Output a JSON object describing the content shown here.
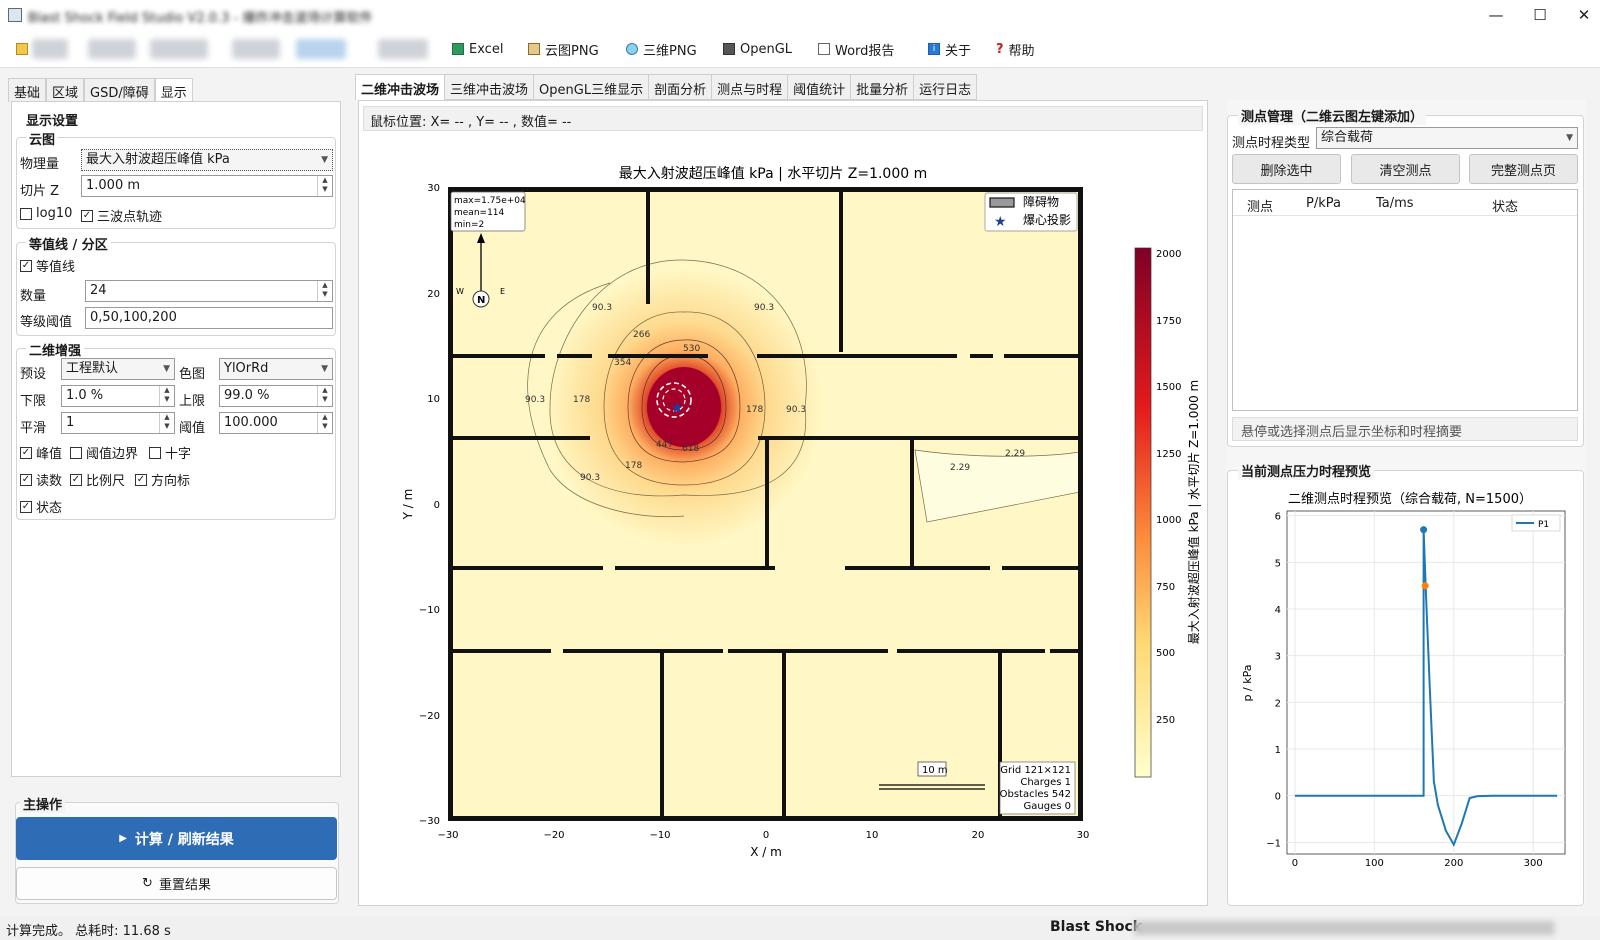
{
  "window": {
    "title": "Blast Shock Field Studio V2.0.3 - 爆炸冲击波场计算软件",
    "controls": [
      "—",
      "☐",
      "✕"
    ]
  },
  "toolbar": {
    "items": [
      {
        "label": "Excel",
        "icon": "excel-icon"
      },
      {
        "label": "云图PNG",
        "icon": "image-icon"
      },
      {
        "label": "三维PNG",
        "icon": "globe-icon"
      },
      {
        "label": "OpenGL",
        "icon": "opengl-icon"
      },
      {
        "label": "Word报告",
        "icon": "document-icon"
      },
      {
        "label": "关于",
        "icon": "info-icon"
      },
      {
        "label": "帮助",
        "icon": "help-icon"
      }
    ]
  },
  "left_tabs": [
    "基础",
    "区域",
    "GSD/障碍",
    "显示"
  ],
  "display": {
    "title": "显示设置",
    "cloud": {
      "title": "云图",
      "quantity_label": "物理量",
      "quantity_value": "最大入射波超压峰值 kPa",
      "slice_label": "切片 Z",
      "slice_value": "1.000 m",
      "log10_label": "log10",
      "log10_checked": false,
      "triple_label": "三波点轨迹",
      "triple_checked": true
    },
    "contour": {
      "title": "等值线 / 分区",
      "enable_label": "等值线",
      "enable_checked": true,
      "count_label": "数量",
      "count_value": "24",
      "levels_label": "等级阈值",
      "levels_value": "0,50,100,200"
    },
    "enhance": {
      "title": "二维增强",
      "preset_label": "预设",
      "preset_value": "工程默认",
      "cmap_label": "色图",
      "cmap_value": "YlOrRd",
      "lower_label": "下限",
      "lower_value": "1.0 %",
      "upper_label": "上限",
      "upper_value": "99.0 %",
      "smooth_label": "平滑",
      "smooth_value": "1",
      "thresh_label": "阈值",
      "thresh_value": "100.000",
      "checks": [
        {
          "label": "峰值",
          "checked": true
        },
        {
          "label": "阈值边界",
          "checked": false
        },
        {
          "label": "十字",
          "checked": false
        },
        {
          "label": "读数",
          "checked": true
        },
        {
          "label": "比例尺",
          "checked": true
        },
        {
          "label": "方向标",
          "checked": true
        },
        {
          "label": "状态",
          "checked": true
        }
      ]
    }
  },
  "main_ops": {
    "title": "主操作",
    "compute_label": "计算 / 刷新结果",
    "reset_label": "重置结果"
  },
  "center_tabs": [
    "二维冲击波场",
    "三维冲击波场",
    "OpenGL三维显示",
    "剖面分析",
    "测点与时程",
    "阈值统计",
    "批量分析",
    "运行日志"
  ],
  "mouse_position": "鼠标位置: X= -- , Y= -- , 数值= --",
  "main_plot": {
    "title": "最大入射波超压峰值 kPa  |  水平切片 Z=1.000 m",
    "xlabel": "X / m",
    "ylabel": "Y / m",
    "xticks": [
      "−30",
      "−20",
      "−10",
      "0",
      "10",
      "20",
      "30"
    ],
    "yticks": [
      "30",
      "20",
      "10",
      "0",
      "−10",
      "−20",
      "−30"
    ],
    "stats": [
      "max=1.75e+04",
      "mean=114",
      "min=2"
    ],
    "legend": [
      "障碍物",
      "爆心投影"
    ],
    "colorbar_label": "最大入射波超压峰值 kPa  |  水平切片 Z=1.000 m",
    "colorbar_ticks": [
      "2000",
      "1750",
      "1500",
      "1250",
      "1000",
      "750",
      "500",
      "250"
    ],
    "scale_label": "10 m",
    "grid_info": [
      "Grid 121×121",
      "Charges 1",
      "Obstacles 542",
      "Gauges 0"
    ],
    "contour_labels": [
      "90.3",
      "266",
      "354",
      "530",
      "178",
      "90.3",
      "178",
      "90.3",
      "178",
      "90.3",
      "90.3",
      "447",
      "618",
      "2.29",
      "2.29"
    ],
    "compass": {
      "n": "N",
      "w": "W",
      "e": "E"
    }
  },
  "gauges": {
    "title": "测点管理（二维云图左键添加）",
    "type_label": "测点时程类型",
    "type_value": "综合载荷",
    "delete_label": "删除选中",
    "clear_label": "清空测点",
    "page_label": "完整测点页",
    "columns": [
      "测点",
      "P/kPa",
      "Ta/ms",
      "状态"
    ],
    "hint": "悬停或选择测点后显示坐标和时程摘要"
  },
  "preview": {
    "title": "当前测点压力时程预览",
    "plot_title": "二维测点时程预览（综合载荷, N=1500）",
    "ylabel": "p / kPa",
    "yticks": [
      "6",
      "5",
      "4",
      "3",
      "2",
      "1",
      "0",
      "−1"
    ],
    "xticks": [
      "0",
      "100",
      "200",
      "300"
    ],
    "legend": "P1"
  },
  "chart_data": {
    "type": "line",
    "title": "二维测点时程预览（综合载荷, N=1500）",
    "xlabel": "",
    "ylabel": "p / kPa",
    "xlim": [
      -10,
      340
    ],
    "ylim": [
      -1.25,
      6.1
    ],
    "series": [
      {
        "name": "P1",
        "x": [
          0,
          162,
          162,
          165,
          170,
          175,
          180,
          190,
          200,
          210,
          220,
          230,
          250,
          300,
          330
        ],
        "y": [
          0,
          0,
          5.7,
          4.3,
          2.2,
          0.3,
          -0.2,
          -0.75,
          -1.05,
          -0.6,
          -0.05,
          -0.01,
          0,
          0,
          0
        ]
      }
    ],
    "markers": [
      {
        "x": 162,
        "y": 5.7
      },
      {
        "x": 164,
        "y": 4.5
      }
    ]
  },
  "status": {
    "left": "计算完成。 总耗时: 11.68 s",
    "right": "Blast Shock"
  }
}
